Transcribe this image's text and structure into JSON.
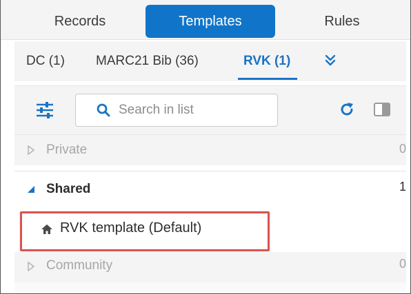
{
  "mode_tabs": [
    {
      "label": "Records",
      "active": false
    },
    {
      "label": "Templates",
      "active": true
    },
    {
      "label": "Rules",
      "active": false
    }
  ],
  "sub_tabs": [
    {
      "label": "DC (1)",
      "active": false
    },
    {
      "label": "MARC21 Bib (36)",
      "active": false
    },
    {
      "label": "RVK (1)",
      "active": true
    }
  ],
  "more_tabs_icon": "double-chevron-down-icon",
  "toolbar": {
    "filter_icon": "sliders-icon",
    "search_placeholder": "Search in list",
    "search_value": "",
    "refresh_icon": "refresh-icon",
    "panel_icon": "panel-toggle-icon"
  },
  "groups": {
    "private": {
      "label": "Private",
      "count": "0",
      "expanded": false
    },
    "shared": {
      "label": "Shared",
      "count": "1",
      "expanded": true,
      "items": [
        {
          "name": "RVK template",
          "tag": "(Default)",
          "icon": "home-icon"
        }
      ]
    },
    "community": {
      "label": "Community",
      "count": "0",
      "expanded": false
    }
  },
  "colors": {
    "accent": "#1075c9",
    "active_subtab": "#1a73c4",
    "highlight_border": "#d9534f",
    "muted_text": "#a6a6a6",
    "panel_bg": "#f4f4f4"
  }
}
